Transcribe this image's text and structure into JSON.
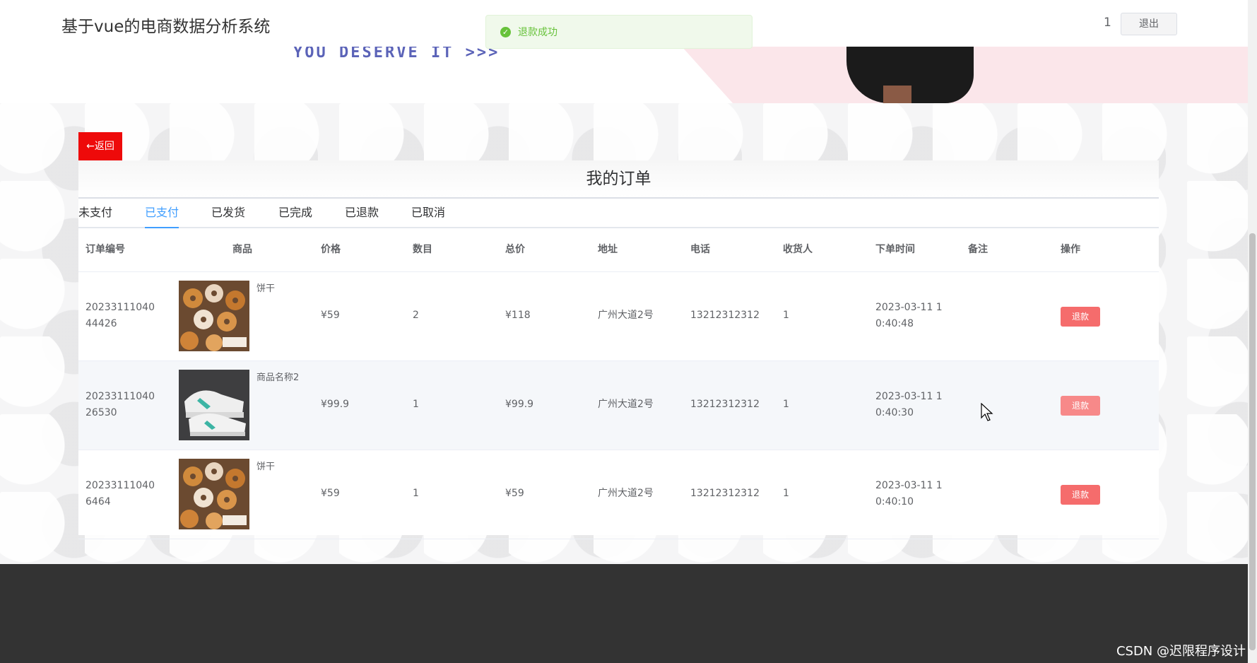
{
  "header": {
    "title": "基于vue的电商数据分析系统",
    "user": "1",
    "logout_label": "退出"
  },
  "banner": {
    "text": "YOU DESERVE IT >>>"
  },
  "toast": {
    "message": "退款成功"
  },
  "back_label": "←返回",
  "panel": {
    "title": "我的订单"
  },
  "tabs": [
    "未支付",
    "已支付",
    "已发货",
    "已完成",
    "已退款",
    "已取消"
  ],
  "active_tab": "已支付",
  "table": {
    "columns": [
      "订单编号",
      "商品",
      "价格",
      "数目",
      "总价",
      "地址",
      "电话",
      "收货人",
      "下单时间",
      "备注",
      "操作"
    ],
    "rows": [
      {
        "order_no": "2023311104044426",
        "product": "饼干",
        "price": "¥59",
        "qty": "2",
        "total": "¥118",
        "address": "广州大道2号",
        "phone": "13212312312",
        "receiver": "1",
        "time": "2023-03-11 10:40:48",
        "remark": "",
        "action": "退款"
      },
      {
        "order_no": "2023311104026530",
        "product": "商品名称2",
        "price": "¥99.9",
        "qty": "1",
        "total": "¥99.9",
        "address": "广州大道2号",
        "phone": "13212312312",
        "receiver": "1",
        "time": "2023-03-11 10:40:30",
        "remark": "",
        "action": "退款"
      },
      {
        "order_no": "202331110406464",
        "product": "饼干",
        "price": "¥59",
        "qty": "1",
        "total": "¥59",
        "address": "广州大道2号",
        "phone": "13212312312",
        "receiver": "1",
        "time": "2023-03-11 10:40:10",
        "remark": "",
        "action": "退款"
      }
    ]
  },
  "watermark": "CSDN @迟限程序设计",
  "colors": {
    "accent": "#409eff",
    "success": "#67c23a",
    "danger": "#f56c6c",
    "back_button": "#ee0a0a",
    "footer": "#333333"
  }
}
